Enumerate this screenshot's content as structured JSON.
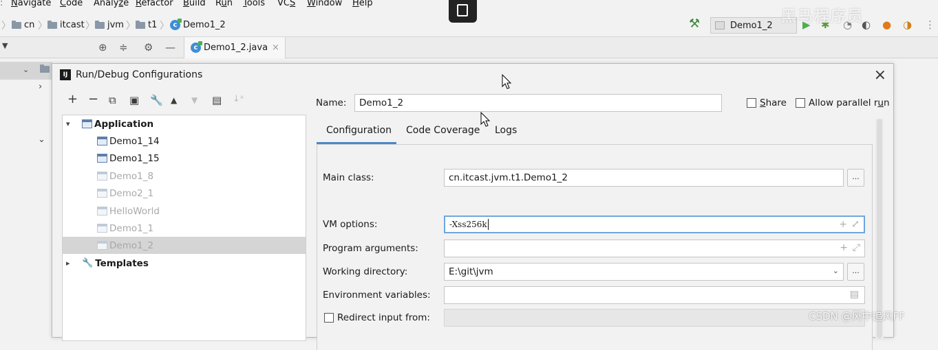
{
  "menubar": {
    "items": [
      {
        "pre": "",
        "mn": "N",
        "post": "avigate"
      },
      {
        "pre": "",
        "mn": "C",
        "post": "ode"
      },
      {
        "pre": "Analy",
        "mn": "z",
        "post": "e"
      },
      {
        "pre": "",
        "mn": "R",
        "post": "efactor"
      },
      {
        "pre": "",
        "mn": "B",
        "post": "uild"
      },
      {
        "pre": "R",
        "mn": "u",
        "post": "n"
      },
      {
        "pre": "",
        "mn": "T",
        "post": "ools"
      },
      {
        "pre": "VC",
        "mn": "S",
        "post": ""
      },
      {
        "pre": "",
        "mn": "W",
        "post": "indow"
      },
      {
        "pre": "",
        "mn": "H",
        "post": "elp"
      }
    ]
  },
  "breadcrumb": {
    "items": [
      "cn",
      "itcast",
      "jvm",
      "t1",
      "Demo1_2"
    ]
  },
  "run_config": {
    "selected": "Demo1_2"
  },
  "editor": {
    "tab_label": "Demo1_2.java",
    "tab_close": "×"
  },
  "dialog": {
    "title": "Run/Debug Configurations",
    "logo_text": "IJ",
    "close": "×",
    "tree": {
      "application_label": "Application",
      "items": [
        "Demo1_14",
        "Demo1_15",
        "Demo1_8",
        "Demo2_1",
        "HelloWorld",
        "Demo1_1",
        "Demo1_2"
      ],
      "templates_label": "Templates"
    },
    "name_label": "Name:",
    "name_value": "Demo1_2",
    "share_pre": "",
    "share_mn": "S",
    "share_post": "hare",
    "parallel_pre": "Allow parallel r",
    "parallel_mn": "u",
    "parallel_post": "n",
    "tabs": [
      "Configuration",
      "Code Coverage",
      "Logs"
    ],
    "main_class_label": "Main class:",
    "main_class_value": "cn.itcast.jvm.t1.Demo1_2",
    "vm_options_label": "VM options:",
    "vm_options_value": "-Xss256k",
    "program_args_label": "Program arguments:",
    "working_dir_label": "Working directory:",
    "working_dir_value": "E:\\git\\jvm",
    "env_vars_label": "Environment variables:",
    "redirect_label": "Redirect input from:",
    "dots": "..."
  },
  "watermark": {
    "top": "黑马程序员",
    "csdn": "CSDN @风中追风FF"
  }
}
